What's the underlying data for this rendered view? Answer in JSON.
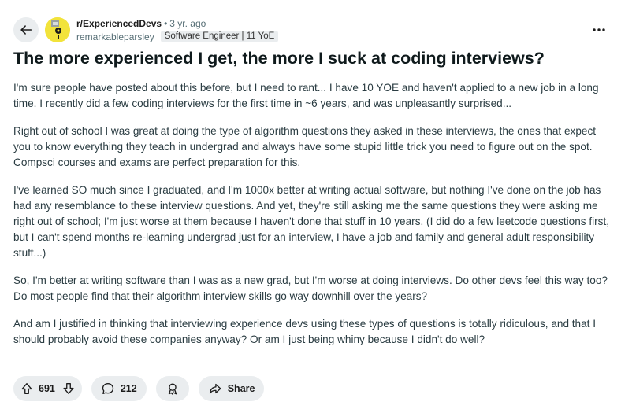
{
  "header": {
    "subreddit": "r/ExperiencedDevs",
    "separator": "•",
    "age": "3 yr. ago",
    "username": "remarkableparsley",
    "flair": "Software Engineer | 11 YoE",
    "more": "•••"
  },
  "post": {
    "title": "The more experienced I get, the more I suck at coding interviews?",
    "paragraphs": [
      "I'm sure people have posted about this before, but I need to rant... I have 10 YOE and haven't applied to a new job in a long time. I recently did a few coding interviews for the first time in ~6 years, and was unpleasantly surprised...",
      "Right out of school I was great at doing the type of algorithm questions they asked in these interviews, the ones that expect you to know everything they teach in undergrad and always have some stupid little trick you need to figure out on the spot. Compsci courses and exams are perfect preparation for this.",
      "I've learned SO much since I graduated, and I'm 1000x better at writing actual software, but nothing I've done on the job has had any resemblance to these interview questions. And yet, they're still asking me the same questions they were asking me right out of school; I'm just worse at them because I haven't done that stuff in 10 years. (I did do a few leetcode questions first, but I can't spend months re-learning undergrad just for an interview, I have a job and family and general adult responsibility stuff...)",
      "So, I'm better at writing software than I was as a new grad, but I'm worse at doing interviews. Do other devs feel this way too? Do most people find that their algorithm interview skills go way downhill over the years?",
      "And am I justified in thinking that interviewing experience devs using these types of questions is totally ridiculous, and that I should probably avoid these companies anyway? Or am I just being whiny because I didn't do well?"
    ]
  },
  "actions": {
    "votes": "691",
    "comments": "212",
    "share": "Share"
  },
  "icons": {
    "back": "arrow-left-icon",
    "upvote": "arrow-up-icon",
    "downvote": "arrow-down-icon",
    "comment": "speech-bubble-icon",
    "award": "award-icon",
    "share": "share-arrow-icon"
  },
  "colors": {
    "avatar": "#f2e33b",
    "pill_bg": "#eaedef",
    "muted_text": "#576f76"
  }
}
